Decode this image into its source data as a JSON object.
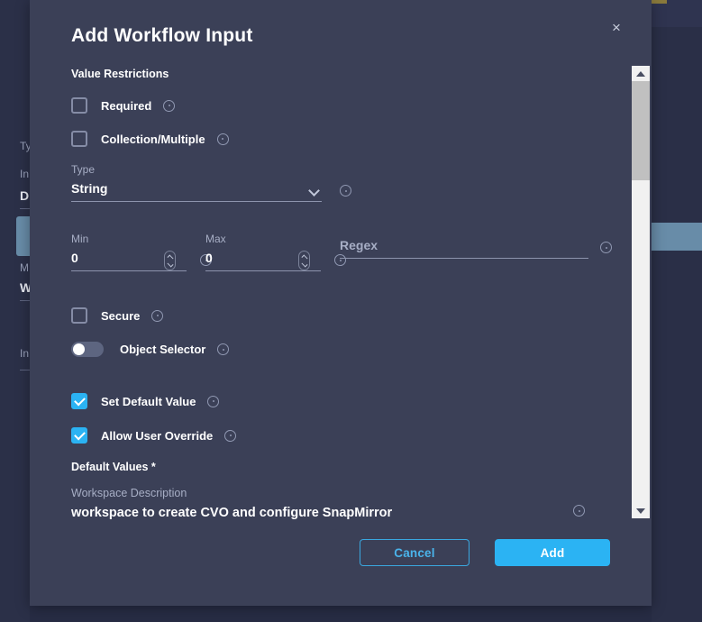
{
  "background": {
    "fields": [
      {
        "label": "Ty",
        "value": null
      },
      {
        "label": "In",
        "value": "Di"
      },
      {
        "label": "M",
        "value": "W"
      },
      {
        "label": "In",
        "value": null
      }
    ]
  },
  "modal": {
    "title": "Add Workflow Input",
    "close_label": "×",
    "section_value_restrictions": "Value Restrictions",
    "checkboxes": [
      {
        "label": "Required",
        "checked": false
      },
      {
        "label": "Collection/Multiple",
        "checked": false
      },
      {
        "label": "Secure",
        "checked": false
      },
      {
        "label": "Set Default Value",
        "checked": true
      },
      {
        "label": "Allow User Override",
        "checked": true
      }
    ],
    "type_field": {
      "label": "Type",
      "value": "String"
    },
    "min_field": {
      "label": "Min",
      "value": "0"
    },
    "max_field": {
      "label": "Max",
      "value": "0"
    },
    "regex_field": {
      "label": "",
      "value": "",
      "placeholder": "Regex"
    },
    "object_selector": {
      "label": "Object Selector",
      "enabled": false
    },
    "default_values": {
      "heading": "Default Values *",
      "item_label": "Workspace Description",
      "item_value": "workspace to create CVO and configure SnapMirror"
    },
    "footer": {
      "cancel_label": "Cancel",
      "add_label": "Add"
    }
  },
  "colors": {
    "accent": "#2bb3f3",
    "modal_bg": "#3b4057",
    "page_bg": "#272c44",
    "highlight": "#688ca8"
  }
}
